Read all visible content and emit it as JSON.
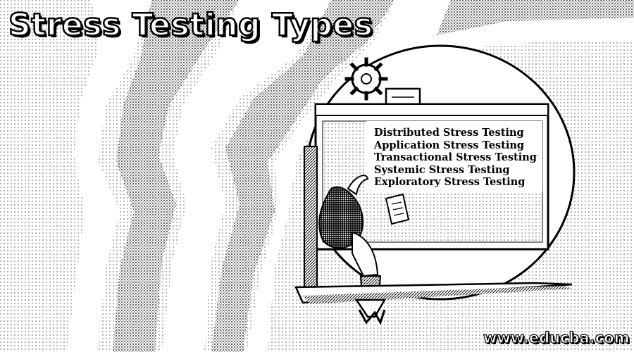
{
  "title": "Stress Testing Types",
  "types": [
    "Distributed Stress Testing",
    "Application Stress Testing",
    "Transactional Stress Testing",
    "Systemic Stress Testing",
    "Exploratory Stress Testing"
  ],
  "watermark": "www.educba.com",
  "colors": {
    "ink": "#000000",
    "paper": "#ffffff",
    "stipple": "#9a9a9a"
  },
  "icons": [
    "gear-icon",
    "chat-bubble-icon",
    "document-icon",
    "person-figure"
  ]
}
